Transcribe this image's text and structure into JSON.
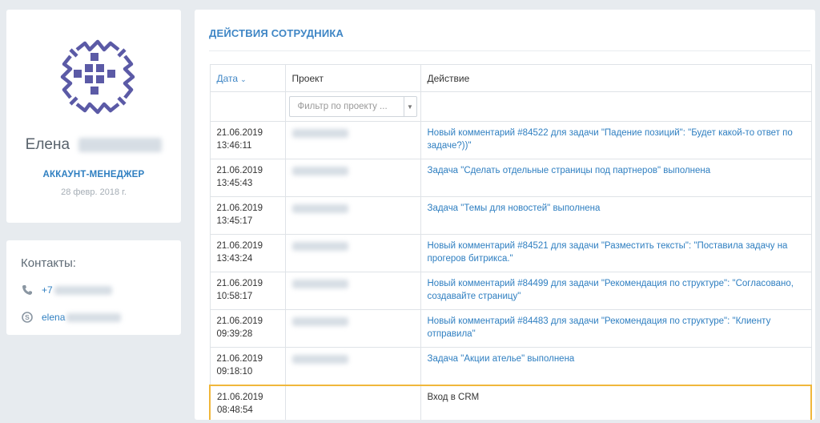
{
  "profile": {
    "first_name": "Елена",
    "role": "АККАУНТ-МЕНЕДЖЕР",
    "since": "28 февр. 2018 г."
  },
  "contacts": {
    "title": "Контакты:",
    "phone": "+7",
    "skype": "elena"
  },
  "actions": {
    "title": "ДЕЙСТВИЯ СОТРУДНИКА",
    "columns": {
      "date": "Дата",
      "project": "Проект",
      "action": "Действие"
    },
    "filter_placeholder": "Фильтр по проекту ...",
    "rows": [
      {
        "date": "21.06.2019",
        "time": "13:46:11",
        "action": "Новый комментарий #84522 для задачи \"Падение позиций\": \"Будет какой-то ответ по задаче?))\""
      },
      {
        "date": "21.06.2019",
        "time": "13:45:43",
        "action": "Задача \"Сделать отдельные страницы под партнеров\" выполнена"
      },
      {
        "date": "21.06.2019",
        "time": "13:45:17",
        "action": "Задача \"Темы для новостей\" выполнена"
      },
      {
        "date": "21.06.2019",
        "time": "13:43:24",
        "action": "Новый комментарий #84521 для задачи \"Разместить тексты\": \"Поставила задачу на прогеров битрикса.\""
      },
      {
        "date": "21.06.2019",
        "time": "10:58:17",
        "action": "Новый комментарий #84499 для задачи \"Рекомендация по структуре\": \"Согласовано, создавайте страницу\""
      },
      {
        "date": "21.06.2019",
        "time": "09:39:28",
        "action": "Новый комментарий #84483 для задачи \"Рекомендация по структуре\": \"Клиенту отправила\""
      },
      {
        "date": "21.06.2019",
        "time": "09:18:10",
        "action": "Задача \"Акции ателье\" выполнена"
      },
      {
        "date": "21.06.2019",
        "time": "08:48:54",
        "action": "Вход в CRM"
      }
    ]
  },
  "colors": {
    "accent": "#2f7fc1",
    "logo": "#5b5aa6",
    "highlight": "#f0b73b",
    "background": "#e7ebef"
  }
}
